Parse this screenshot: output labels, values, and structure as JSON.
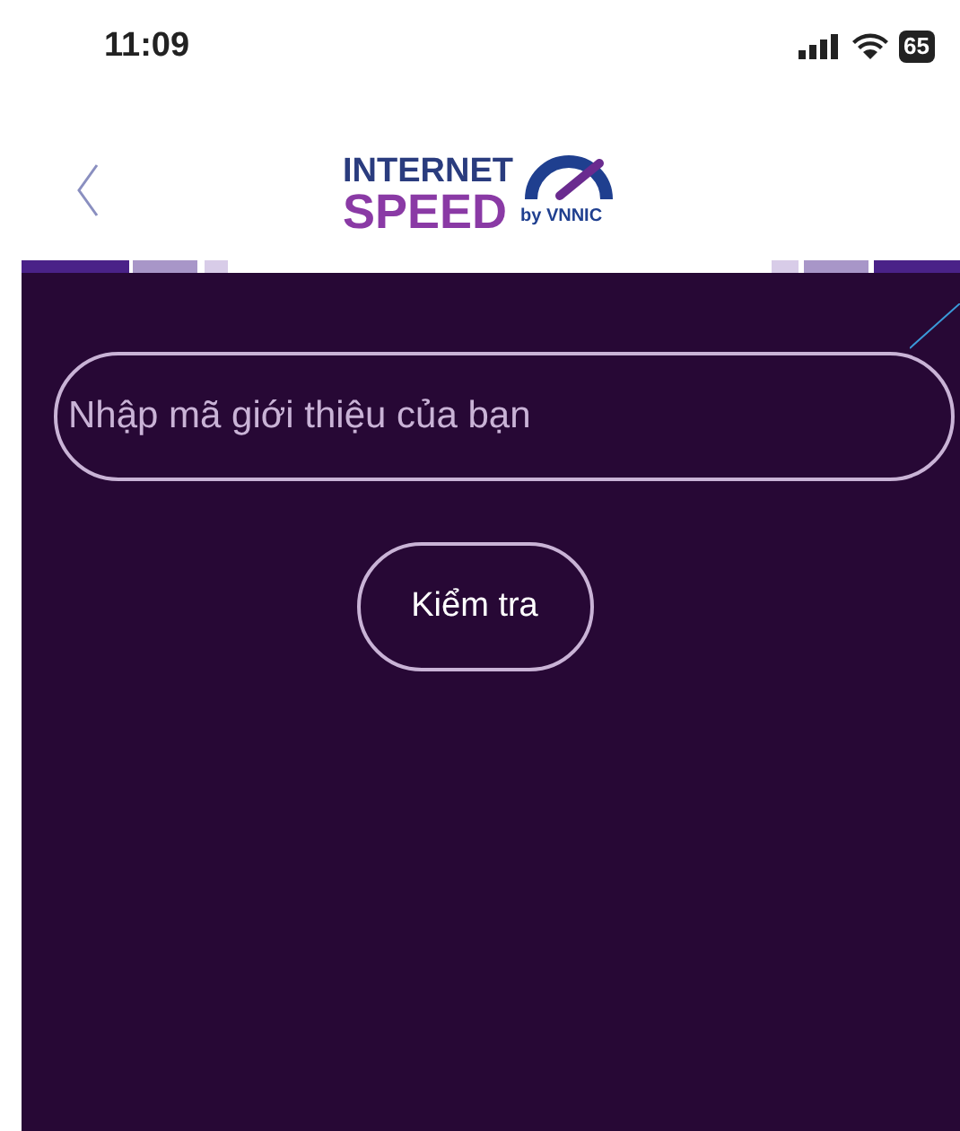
{
  "status_bar": {
    "time": "11:09",
    "battery": "65"
  },
  "header": {
    "logo": {
      "line_1": "INTERNET",
      "line_2": "SPEED",
      "byline": "by VNNIC"
    }
  },
  "form": {
    "code_field": {
      "placeholder": "Nhập mã giới thiệu của bạn"
    },
    "check_button": "Kiểm tra"
  }
}
